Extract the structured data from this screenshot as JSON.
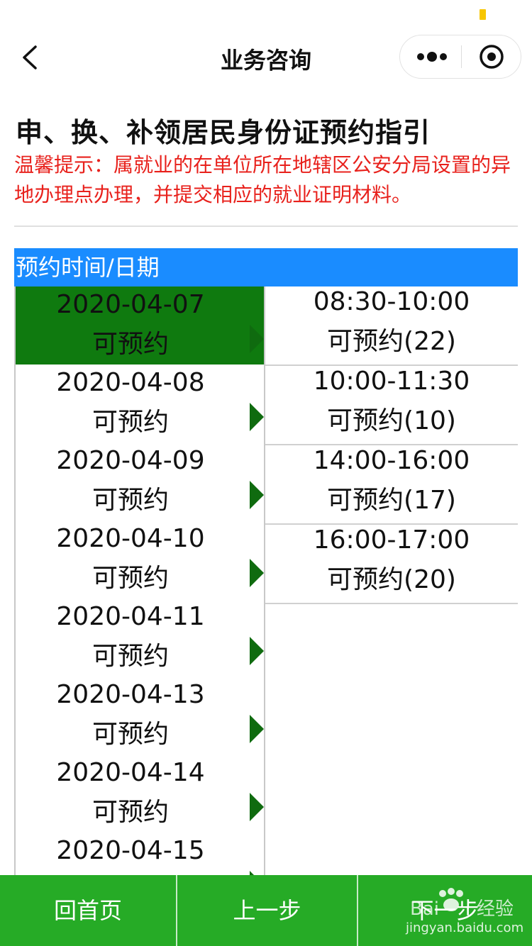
{
  "navbar": {
    "title": "业务咨询",
    "icons": {
      "back": "chevron-left-icon",
      "more": "more-dots-icon",
      "close": "target-circle-icon"
    }
  },
  "content": {
    "title": "申、换、补领居民身份证预约指引",
    "tip": " 温馨提示：属就业的在单位所在地辖区公安分局设置的异地办理点办理，并提交相应的就业证明材料。"
  },
  "section": {
    "header": "预约时间/日期"
  },
  "dates": [
    {
      "date": "2020-04-07",
      "status": "可预约",
      "selected": true
    },
    {
      "date": "2020-04-08",
      "status": "可预约"
    },
    {
      "date": "2020-04-09",
      "status": "可预约"
    },
    {
      "date": "2020-04-10",
      "status": "可预约"
    },
    {
      "date": "2020-04-11",
      "status": "可预约"
    },
    {
      "date": "2020-04-13",
      "status": "可预约"
    },
    {
      "date": "2020-04-14",
      "status": "可预约"
    },
    {
      "date": "2020-04-15",
      "status": ""
    }
  ],
  "slots": [
    {
      "time": "08:30-10:00",
      "availability": "可预约(22)"
    },
    {
      "time": "10:00-11:30",
      "availability": "可预约(10)"
    },
    {
      "time": "14:00-16:00",
      "availability": "可预约(17)"
    },
    {
      "time": "16:00-17:00",
      "availability": "可预约(20)"
    }
  ],
  "footer": {
    "home": "回首页",
    "prev": "上一步",
    "next": "下一步"
  },
  "watermark": {
    "text": "jingyan.baidu.com"
  },
  "colors": {
    "accent_blue": "#1a8cff",
    "selected_green": "#0f7a0f",
    "footer_green": "#26ab26",
    "tip_red": "#e8211c"
  }
}
